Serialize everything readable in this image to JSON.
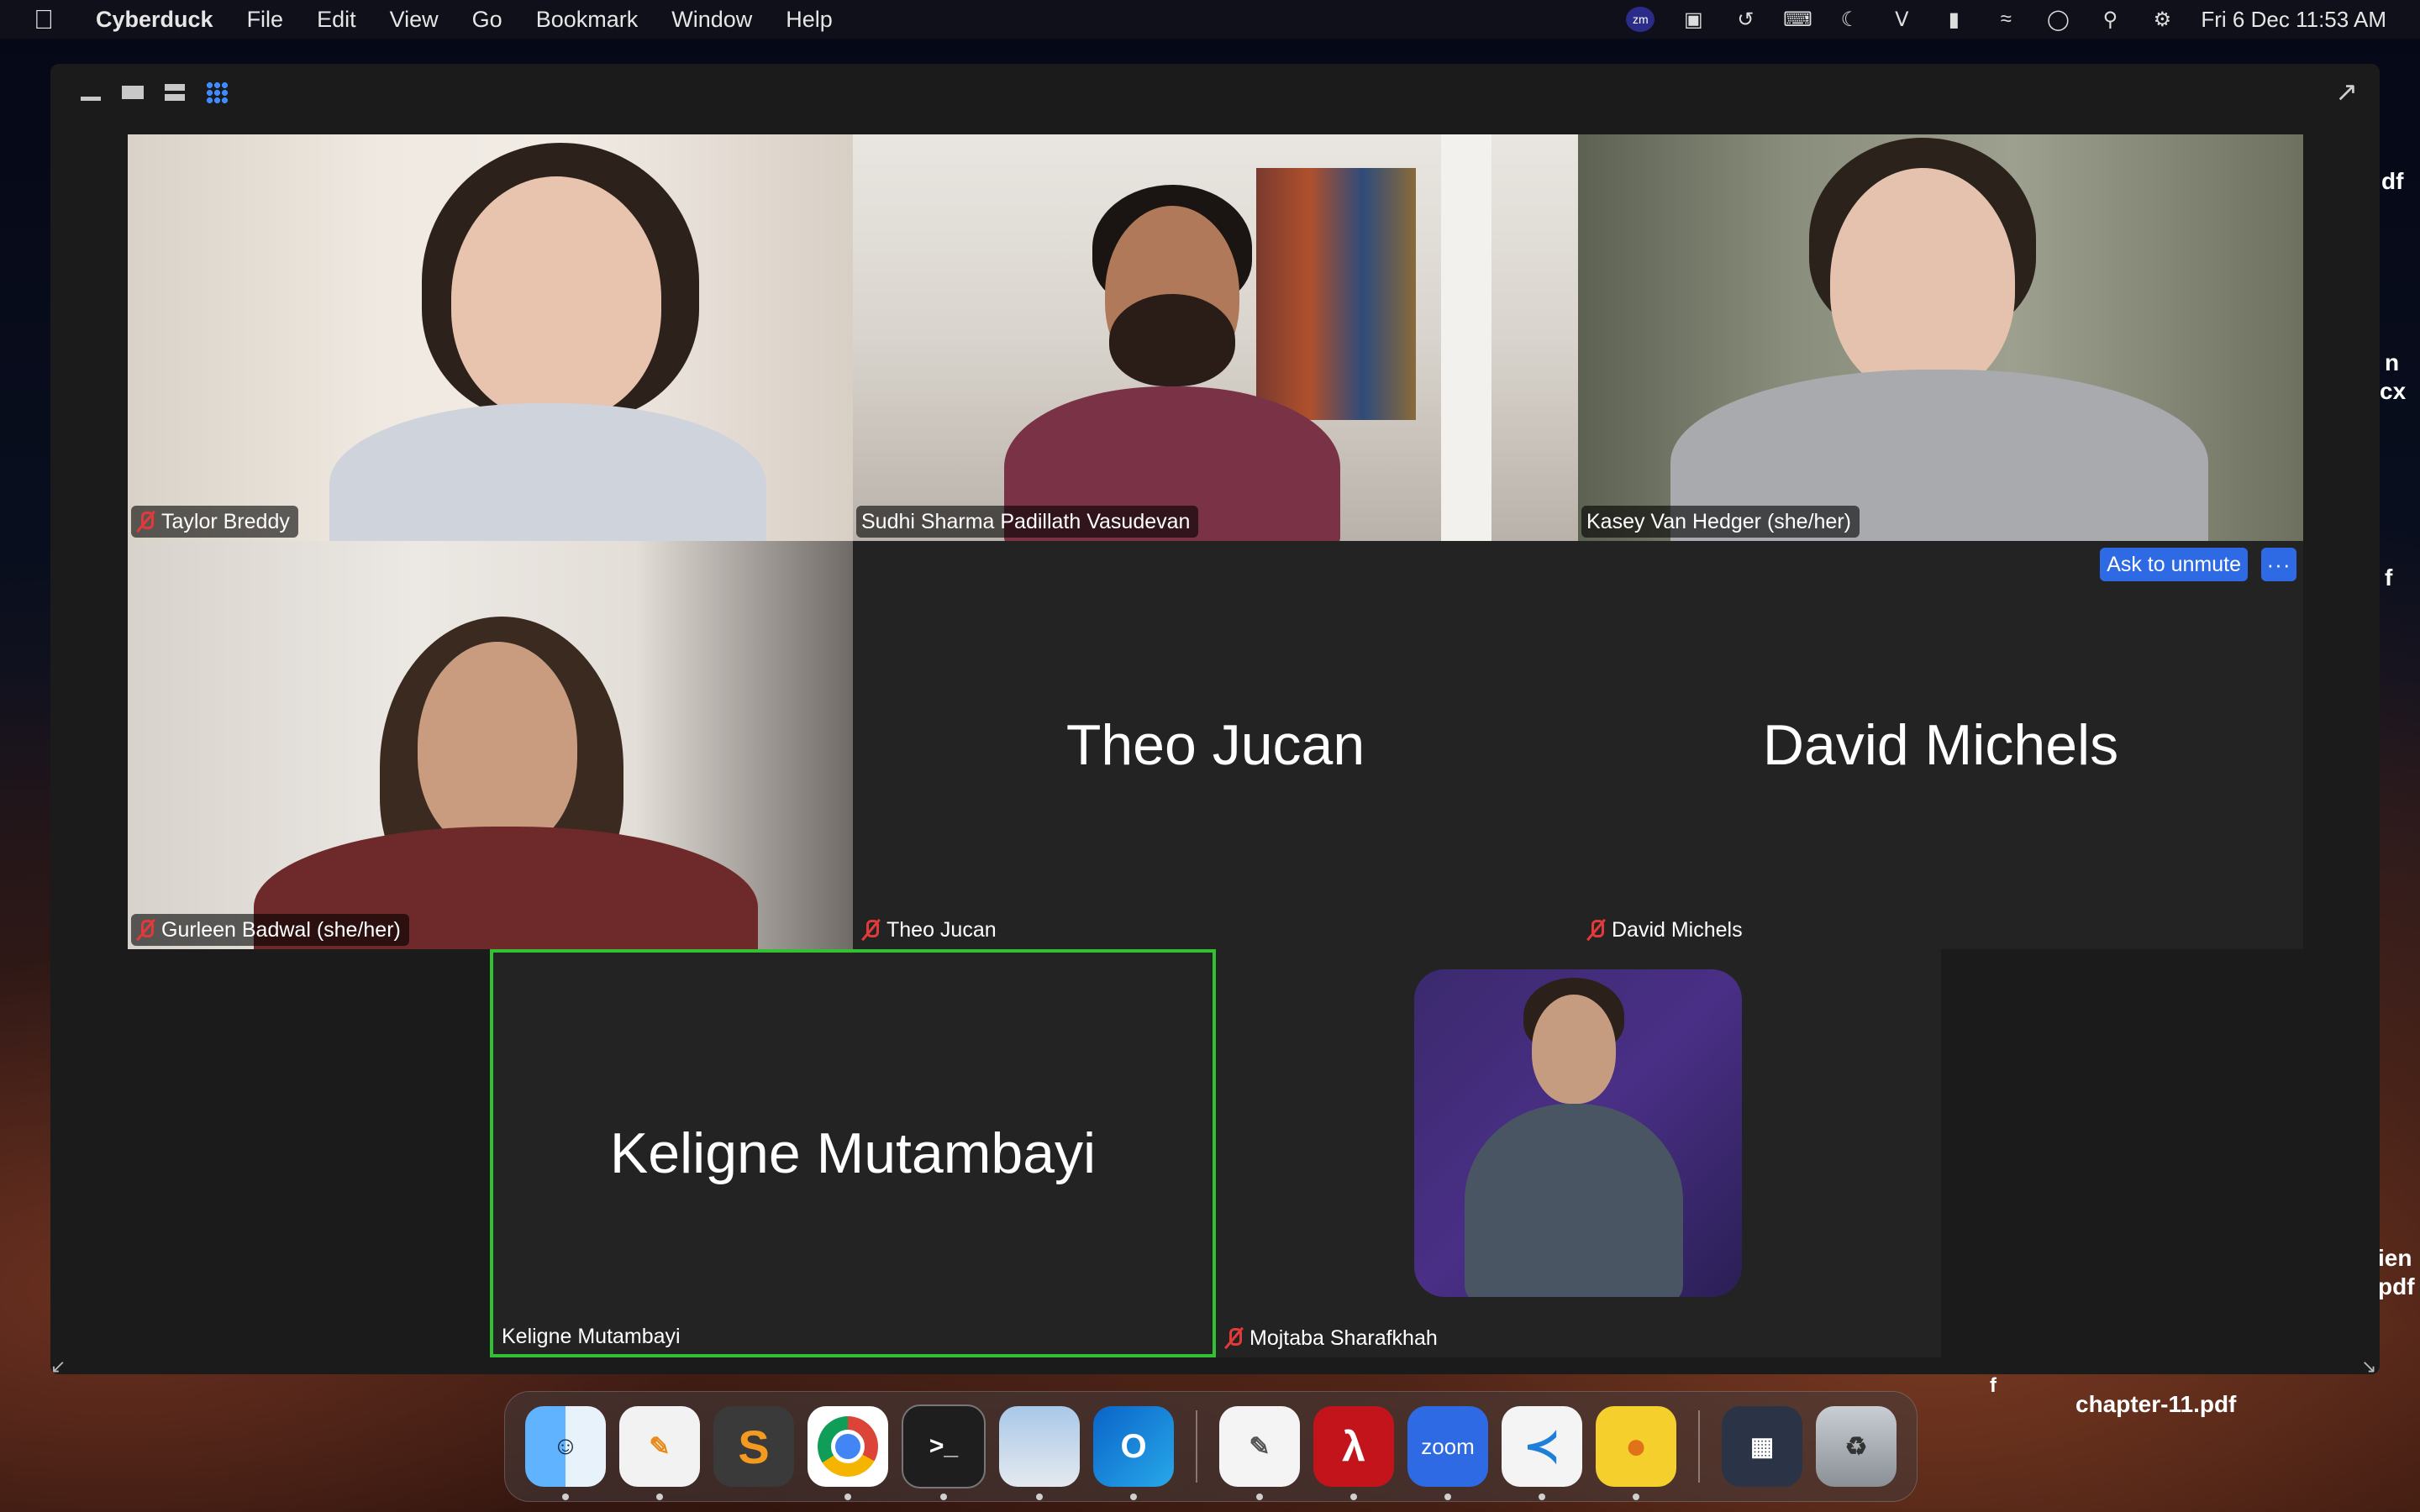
{
  "menubar": {
    "app_name": "Cyberduck",
    "menus": [
      "File",
      "Edit",
      "View",
      "Go",
      "Bookmark",
      "Window",
      "Help"
    ],
    "datetime": "Fri 6 Dec  11:53 AM",
    "zoom_badge": "zm"
  },
  "desktop": {
    "labels": [
      "df",
      "n",
      "cx",
      "f",
      "ien",
      "pdf",
      "f",
      "chapter-11.pdf"
    ]
  },
  "meeting": {
    "tiles": [
      {
        "name": "Taylor Breddy",
        "video": true,
        "muted": true
      },
      {
        "name": "Sudhi Sharma Padillath Vasudevan",
        "video": true,
        "muted": false
      },
      {
        "name": "Kasey Van Hedger (she/her)",
        "video": true,
        "muted": false
      },
      {
        "name": "Gurleen Badwal (she/her)",
        "video": true,
        "muted": true
      },
      {
        "name": "Theo Jucan",
        "video": false,
        "muted": true
      },
      {
        "name": "David Michels",
        "video": false,
        "muted": true
      },
      {
        "name": "Keligne Mutambayi",
        "video": false,
        "muted": false,
        "active_speaker": true
      },
      {
        "name": "Mojtaba Sharafkhah",
        "video": false,
        "muted": true
      }
    ],
    "ask_to_unmute": "Ask to unmute",
    "more": "···"
  },
  "dock": {
    "apps": [
      {
        "name": "Finder",
        "icon": "finder-icon",
        "color": "#2f8ee9"
      },
      {
        "name": "Pages",
        "icon": "pages-icon",
        "color": "#f2f2f2"
      },
      {
        "name": "Sublime Text",
        "icon": "sublime-icon",
        "color": "#3a3a3a"
      },
      {
        "name": "Chrome",
        "icon": "chrome-icon",
        "color": "#ffffff"
      },
      {
        "name": "Terminal",
        "icon": "terminal-icon",
        "color": "#1e1e1e"
      },
      {
        "name": "Preview",
        "icon": "preview-icon",
        "color": "#dfe7ef"
      },
      {
        "name": "Outlook",
        "icon": "outlook-icon",
        "color": "#0a64c8"
      },
      {
        "name": "TextEdit",
        "icon": "textedit-icon",
        "color": "#f4f4f4"
      },
      {
        "name": "Acrobat",
        "icon": "acrobat-icon",
        "color": "#c3141b"
      },
      {
        "name": "Zoom",
        "icon": "zoom-icon",
        "label": "zoom",
        "color": "#2d6ae3"
      },
      {
        "name": "VS Code",
        "icon": "vscode-icon",
        "color": "#f4f4f4"
      },
      {
        "name": "Cyberduck",
        "icon": "cyberduck-icon",
        "color": "#f5cf2c"
      },
      {
        "name": "Mission Control",
        "icon": "missioncontrol-icon",
        "color": "#2a3446"
      },
      {
        "name": "Trash",
        "icon": "trash-icon",
        "color": "#9aa0a6"
      }
    ]
  }
}
